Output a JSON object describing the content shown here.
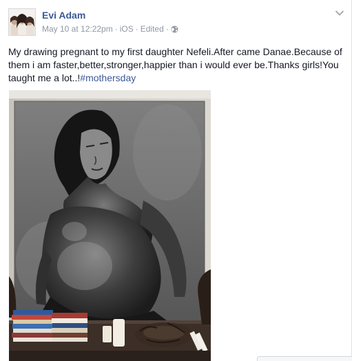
{
  "post": {
    "author": "Evi Adam",
    "date": "May 10 at 12:22pm",
    "separator": "·",
    "source": "iOS",
    "edited": "Edited",
    "privacy_icon": "globe-icon",
    "menu_icon": "chevron-down-icon",
    "text_main": "My drawing pregnant to my first daughter Nefeli.After came Danae.Because of them i am faster,better,stronger,happier than i would ever be.Thanks girls!You taught me a lot..!",
    "hashtag": "#mothersday",
    "photo_description_icon": "charcoal-drawing-photo"
  },
  "colors": {
    "link": "#3b5998",
    "meta": "#9197a3",
    "text": "#141823"
  }
}
